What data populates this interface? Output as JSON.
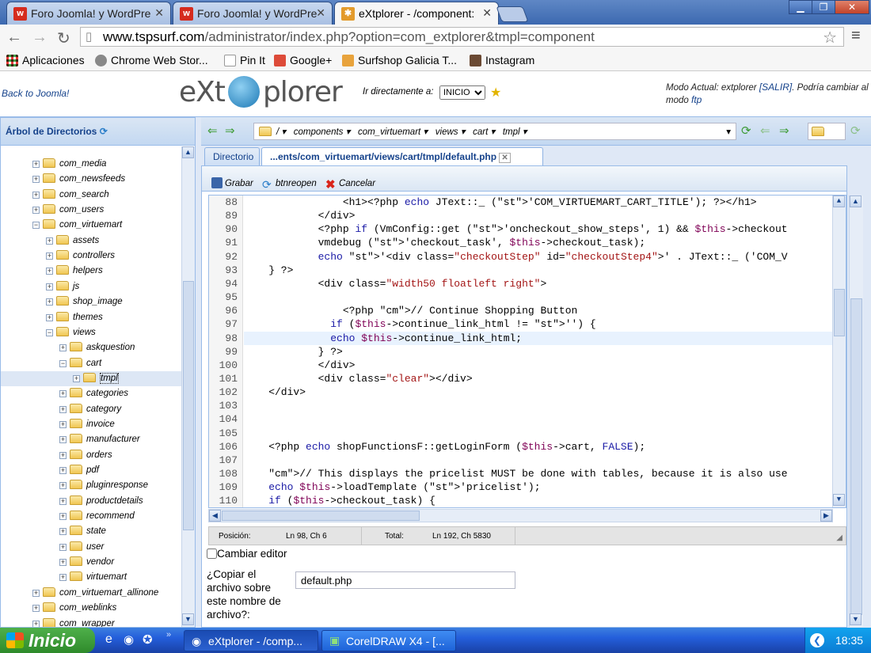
{
  "browser": {
    "tabs": [
      {
        "title": "Foro Joomla! y WordPre",
        "active": false
      },
      {
        "title": "Foro Joomla! y WordPre",
        "active": false
      },
      {
        "title": "eXtplorer - /component:",
        "active": true
      }
    ],
    "url_host": "www.tspsurf.com",
    "url_path": "/administrator/index.php?option=com_extplorer&tmpl=component",
    "bookmarks": [
      "Aplicaciones",
      "Chrome Web Stor...",
      "Pin It",
      "Google+",
      "Surfshop Galicia T...",
      "Instagram"
    ]
  },
  "header": {
    "back_link": "Back to Joomla!",
    "logo_left": "eXt",
    "logo_right": "plorer",
    "goto_label": "Ir directamente a:",
    "goto_value": "INICIO",
    "mode_prefix": "Modo Actual: extplorer",
    "logout": "[SALIR]",
    "mode_suffix": ". Podría cambiar al modo",
    "mode_link": "ftp"
  },
  "sidebar": {
    "title": "Árbol de Directorios",
    "nodes": [
      {
        "label": "com_media",
        "level": 0,
        "open": false
      },
      {
        "label": "com_newsfeeds",
        "level": 0,
        "open": false
      },
      {
        "label": "com_search",
        "level": 0,
        "open": false
      },
      {
        "label": "com_users",
        "level": 0,
        "open": false
      },
      {
        "label": "com_virtuemart",
        "level": 0,
        "open": true
      },
      {
        "label": "assets",
        "level": 1,
        "open": false
      },
      {
        "label": "controllers",
        "level": 1,
        "open": false
      },
      {
        "label": "helpers",
        "level": 1,
        "open": false
      },
      {
        "label": "js",
        "level": 1,
        "open": false
      },
      {
        "label": "shop_image",
        "level": 1,
        "open": false
      },
      {
        "label": "themes",
        "level": 1,
        "open": false
      },
      {
        "label": "views",
        "level": 1,
        "open": true
      },
      {
        "label": "askquestion",
        "level": 2,
        "open": false
      },
      {
        "label": "cart",
        "level": 2,
        "open": true
      },
      {
        "label": "tmpl",
        "level": 3,
        "open": false,
        "selected": true
      },
      {
        "label": "categories",
        "level": 2,
        "open": false
      },
      {
        "label": "category",
        "level": 2,
        "open": false
      },
      {
        "label": "invoice",
        "level": 2,
        "open": false
      },
      {
        "label": "manufacturer",
        "level": 2,
        "open": false
      },
      {
        "label": "orders",
        "level": 2,
        "open": false
      },
      {
        "label": "pdf",
        "level": 2,
        "open": false
      },
      {
        "label": "pluginresponse",
        "level": 2,
        "open": false
      },
      {
        "label": "productdetails",
        "level": 2,
        "open": false
      },
      {
        "label": "recommend",
        "level": 2,
        "open": false
      },
      {
        "label": "state",
        "level": 2,
        "open": false
      },
      {
        "label": "user",
        "level": 2,
        "open": false
      },
      {
        "label": "vendor",
        "level": 2,
        "open": false
      },
      {
        "label": "virtuemart",
        "level": 2,
        "open": false
      },
      {
        "label": "com_virtuemart_allinone",
        "level": 0,
        "open": false
      },
      {
        "label": "com_weblinks",
        "level": 0,
        "open": false
      },
      {
        "label": "com_wrapper",
        "level": 0,
        "open": false
      }
    ]
  },
  "pathbar": {
    "root": "/",
    "segments": [
      "components",
      "com_virtuemart",
      "views",
      "cart",
      "tmpl"
    ]
  },
  "tabs": {
    "dir": "Directorio",
    "file": "...ents/com_virtuemart/views/cart/tmpl/default.php"
  },
  "editor_toolbar": {
    "save": "Grabar",
    "reopen": "btnreopen",
    "cancel": "Cancelar"
  },
  "code": {
    "current_line": 98,
    "lines": [
      {
        "n": "88",
        "t": "                <h1><?php echo JText::_ ('COM_VIRTUEMART_CART_TITLE'); ?></h1>"
      },
      {
        "n": "89",
        "t": "            </div>"
      },
      {
        "n": "90",
        "t": "            <?php if (VmConfig::get ('oncheckout_show_steps', 1) && $this->checkout"
      },
      {
        "n": "91",
        "t": "            vmdebug ('checkout_task', $this->checkout_task);"
      },
      {
        "n": "92",
        "t": "            echo '<div class=\"checkoutStep\" id=\"checkoutStep4\">' . JText::_ ('COM_V"
      },
      {
        "n": "93",
        "t": "    } ?>"
      },
      {
        "n": "94",
        "t": "            <div class=\"width50 floatleft right\">"
      },
      {
        "n": "95",
        "t": ""
      },
      {
        "n": "96",
        "t": "                <?php // Continue Shopping Button"
      },
      {
        "n": "97",
        "t": "              if ($this->continue_link_html != '') {"
      },
      {
        "n": "98",
        "t": "              echo $this->continue_link_html;"
      },
      {
        "n": "99",
        "t": "            } ?>"
      },
      {
        "n": "100",
        "t": "            </div>"
      },
      {
        "n": "101",
        "t": "            <div class=\"clear\"></div>"
      },
      {
        "n": "102",
        "t": "    </div>"
      },
      {
        "n": "103",
        "t": ""
      },
      {
        "n": "104",
        "t": ""
      },
      {
        "n": "105",
        "t": ""
      },
      {
        "n": "106",
        "t": "    <?php echo shopFunctionsF::getLoginForm ($this->cart, FALSE);"
      },
      {
        "n": "107",
        "t": ""
      },
      {
        "n": "108",
        "t": "    // This displays the pricelist MUST be done with tables, because it is also use"
      },
      {
        "n": "109",
        "t": "    echo $this->loadTemplate ('pricelist');"
      },
      {
        "n": "110",
        "t": "    if ($this->checkout_task) {"
      }
    ]
  },
  "statusbar": {
    "pos_label": "Posición:",
    "pos_value": "Ln 98, Ch 6",
    "total_label": "Total:",
    "total_value": "Ln 192, Ch 5830"
  },
  "form": {
    "change_editor": "Cambiar editor",
    "copy_label": "¿Copiar el archivo sobre este nombre de archivo?:",
    "copy_value": "default.php"
  },
  "taskbar": {
    "start": "Inicio",
    "items": [
      "eXtplorer - /comp...",
      "CorelDRAW X4 - [..."
    ],
    "clock": "18:35"
  }
}
